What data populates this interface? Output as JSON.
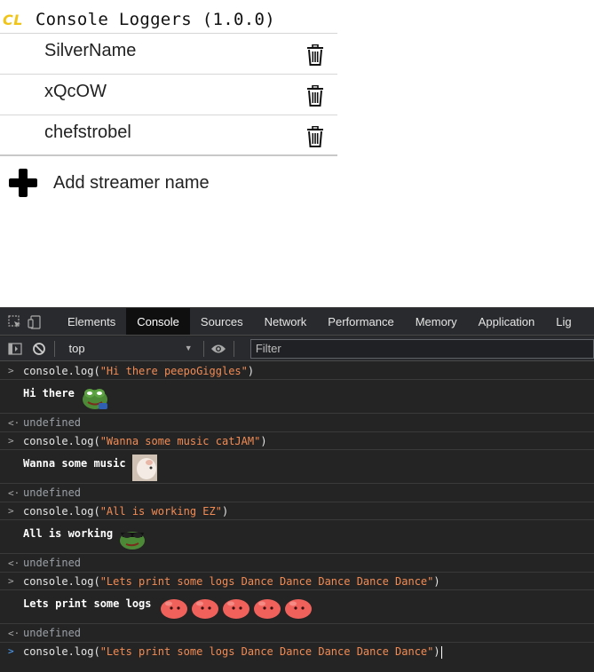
{
  "popup": {
    "logo": "CL",
    "title": "Console Loggers (1.0.0)",
    "streamers": [
      "SilverName",
      "xQcOW",
      "chefstrobel"
    ],
    "add_label": "Add streamer name",
    "logo_color": "#f0c419"
  },
  "devtools": {
    "tabs": [
      "Elements",
      "Console",
      "Sources",
      "Network",
      "Performance",
      "Memory",
      "Application",
      "Lig"
    ],
    "active_tab": "Console",
    "context": "top",
    "filter_placeholder": "Filter",
    "entries": [
      {
        "input_prefix": "console.",
        "input_fn": "log(",
        "input_string": "\"Hi there peepoGiggles\"",
        "input_suffix": ")",
        "output": "Hi there ",
        "emotes": [
          "peepo-giggles-emote"
        ],
        "result": "undefined"
      },
      {
        "input_prefix": "console.",
        "input_fn": "log(",
        "input_string": "\"Wanna some music catJAM\"",
        "input_suffix": ")",
        "output": "Wanna some music ",
        "emotes": [
          "cat-jam-emote"
        ],
        "result": "undefined"
      },
      {
        "input_prefix": "console.",
        "input_fn": "log(",
        "input_string": "\"All is working EZ\"",
        "input_suffix": ")",
        "output": "All is working ",
        "emotes": [
          "ez-emote"
        ],
        "result": "undefined"
      },
      {
        "input_prefix": "console.",
        "input_fn": "log(",
        "input_string": "\"Lets print some logs Dance Dance Dance Dance Dance\"",
        "input_suffix": ")",
        "output": "Lets print some logs ",
        "emotes": [
          "dance-emote",
          "dance-emote",
          "dance-emote",
          "dance-emote",
          "dance-emote"
        ],
        "result": "undefined"
      }
    ],
    "current_input": {
      "prefix": "console.",
      "fn": "log(",
      "string": "\"Lets print some logs Dance Dance Dance Dance Dance\"",
      "suffix": ")"
    },
    "colors": {
      "string": "#f28b54",
      "background": "#242424",
      "prompt_active": "#4da3ff"
    }
  }
}
